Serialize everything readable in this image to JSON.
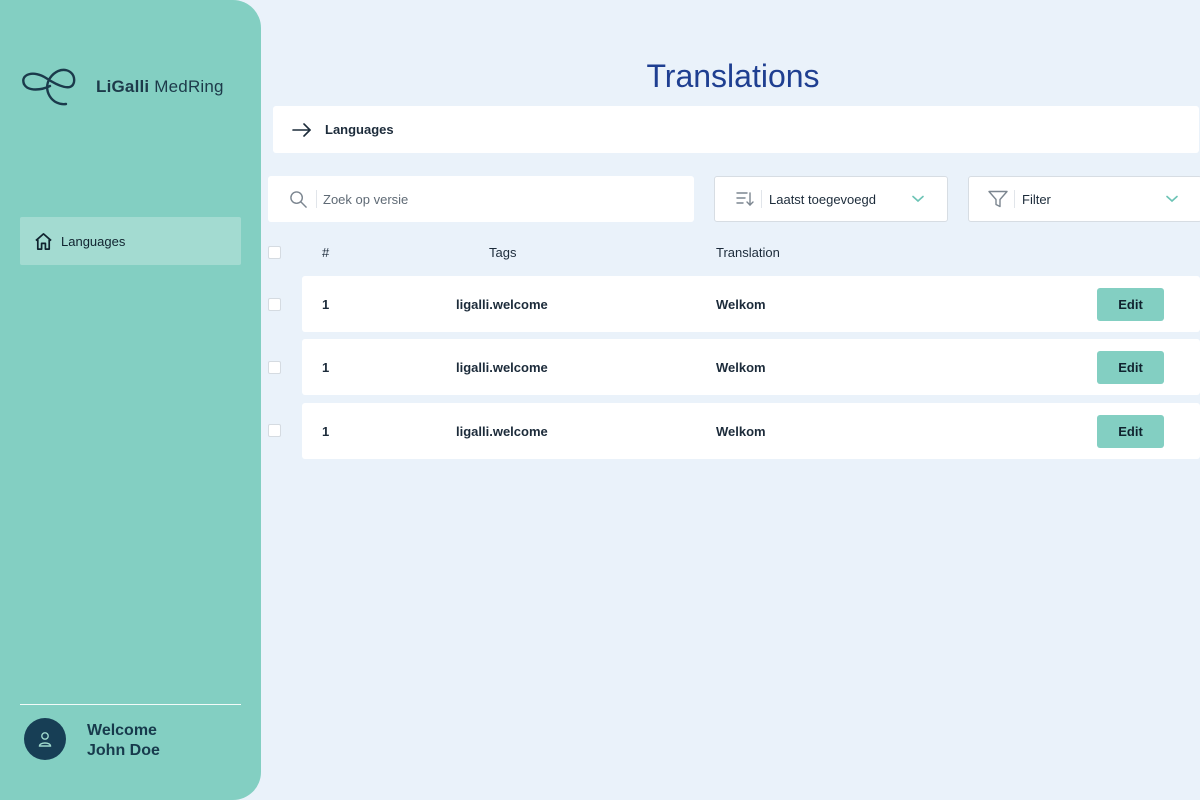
{
  "brand": {
    "name_bold": "LiGalli",
    "name_rest": " MedRing",
    "logo_icon": "ligalli-ring-logo"
  },
  "sidebar": {
    "items": [
      {
        "label": "Languages",
        "icon": "home-icon",
        "active": true
      }
    ]
  },
  "user": {
    "greeting": "Welcome",
    "name": "John Doe",
    "avatar_icon": "user-icon"
  },
  "page": {
    "title": "Translations"
  },
  "breadcrumb": {
    "label": "Languages",
    "icon": "arrow-right-icon"
  },
  "search": {
    "placeholder": "Zoek op versie",
    "value": ""
  },
  "sort": {
    "label": "Laatst toegevoegd",
    "icon": "sort-descending-icon"
  },
  "filter": {
    "label": "Filter",
    "icon": "funnel-icon"
  },
  "table": {
    "headers": [
      "#",
      "Tags",
      "Translation"
    ],
    "rows": [
      {
        "num": "1",
        "tag": "ligalli.welcome",
        "translation": "Welkom",
        "action": "Edit"
      },
      {
        "num": "1",
        "tag": "ligalli.welcome",
        "translation": "Welkom",
        "action": "Edit"
      },
      {
        "num": "1",
        "tag": "ligalli.welcome",
        "translation": "Welkom",
        "action": "Edit"
      }
    ]
  },
  "colors": {
    "sidebar_bg": "#83cfc2",
    "page_bg": "#eaf2fa",
    "title": "#1f3f91",
    "avatar_bg": "#173e55",
    "accent": "#83cfc2"
  }
}
